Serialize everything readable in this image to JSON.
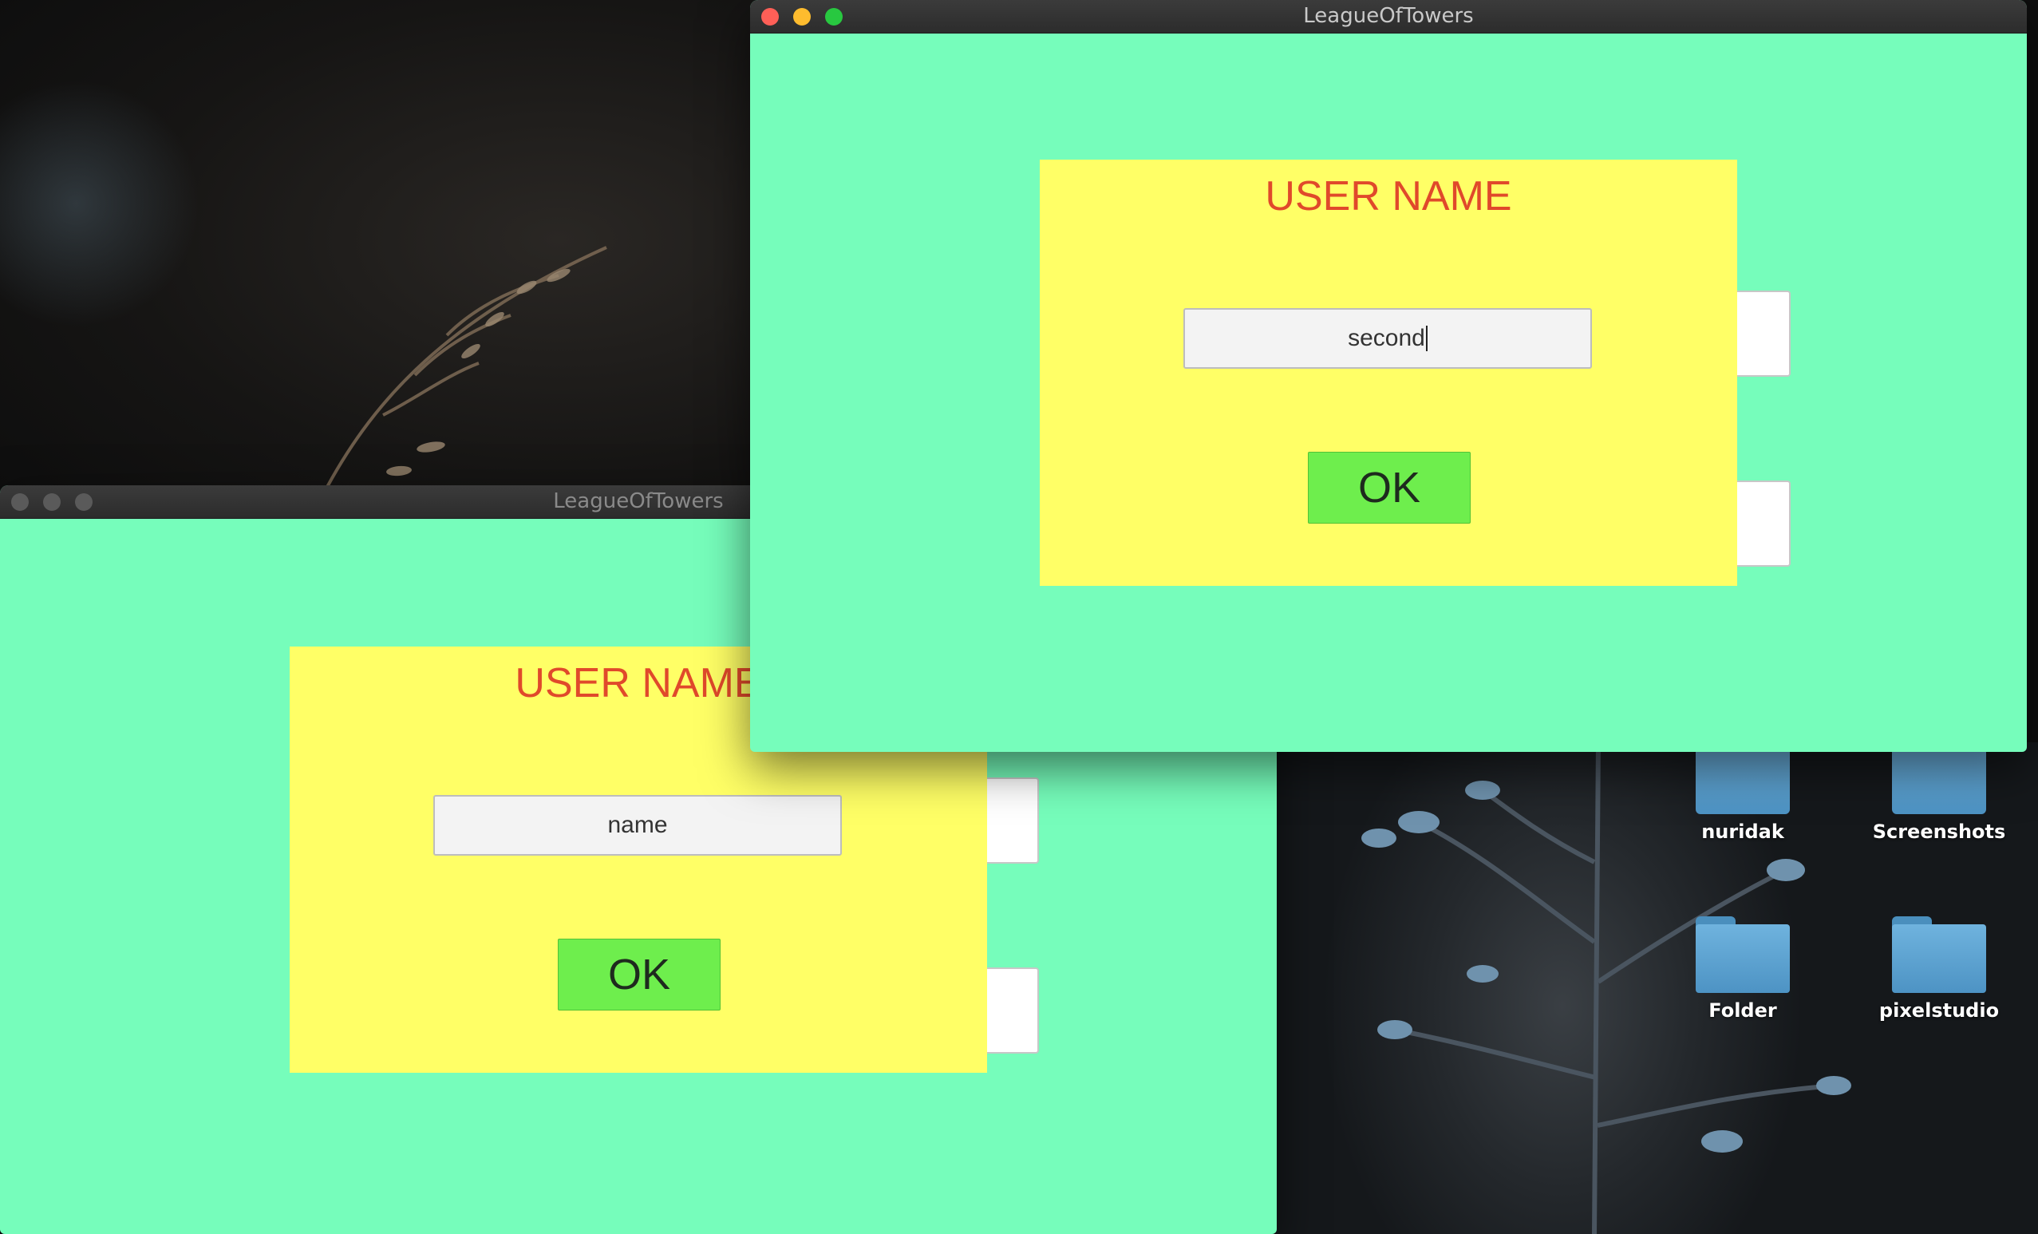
{
  "desktop": {
    "icons": [
      {
        "label": "nuridak",
        "icon": "folder-icon"
      },
      {
        "label": "Screenshots",
        "icon": "folder-icon"
      },
      {
        "label": "Folder",
        "icon": "folder-icon"
      },
      {
        "label": "pixelstudio",
        "icon": "folder-icon"
      }
    ]
  },
  "window_back": {
    "title": "LeagueOfTowers",
    "heading": "USER NAME",
    "input_value": "name",
    "ok_label": "OK"
  },
  "window_front": {
    "title": "LeagueOfTowers",
    "heading": "USER NAME",
    "input_value": "second",
    "ok_label": "OK"
  },
  "colors": {
    "window_bg": "#76fdbb",
    "panel_bg": "#ffff66",
    "heading": "#e0492b",
    "ok_button": "#6eee4d"
  }
}
